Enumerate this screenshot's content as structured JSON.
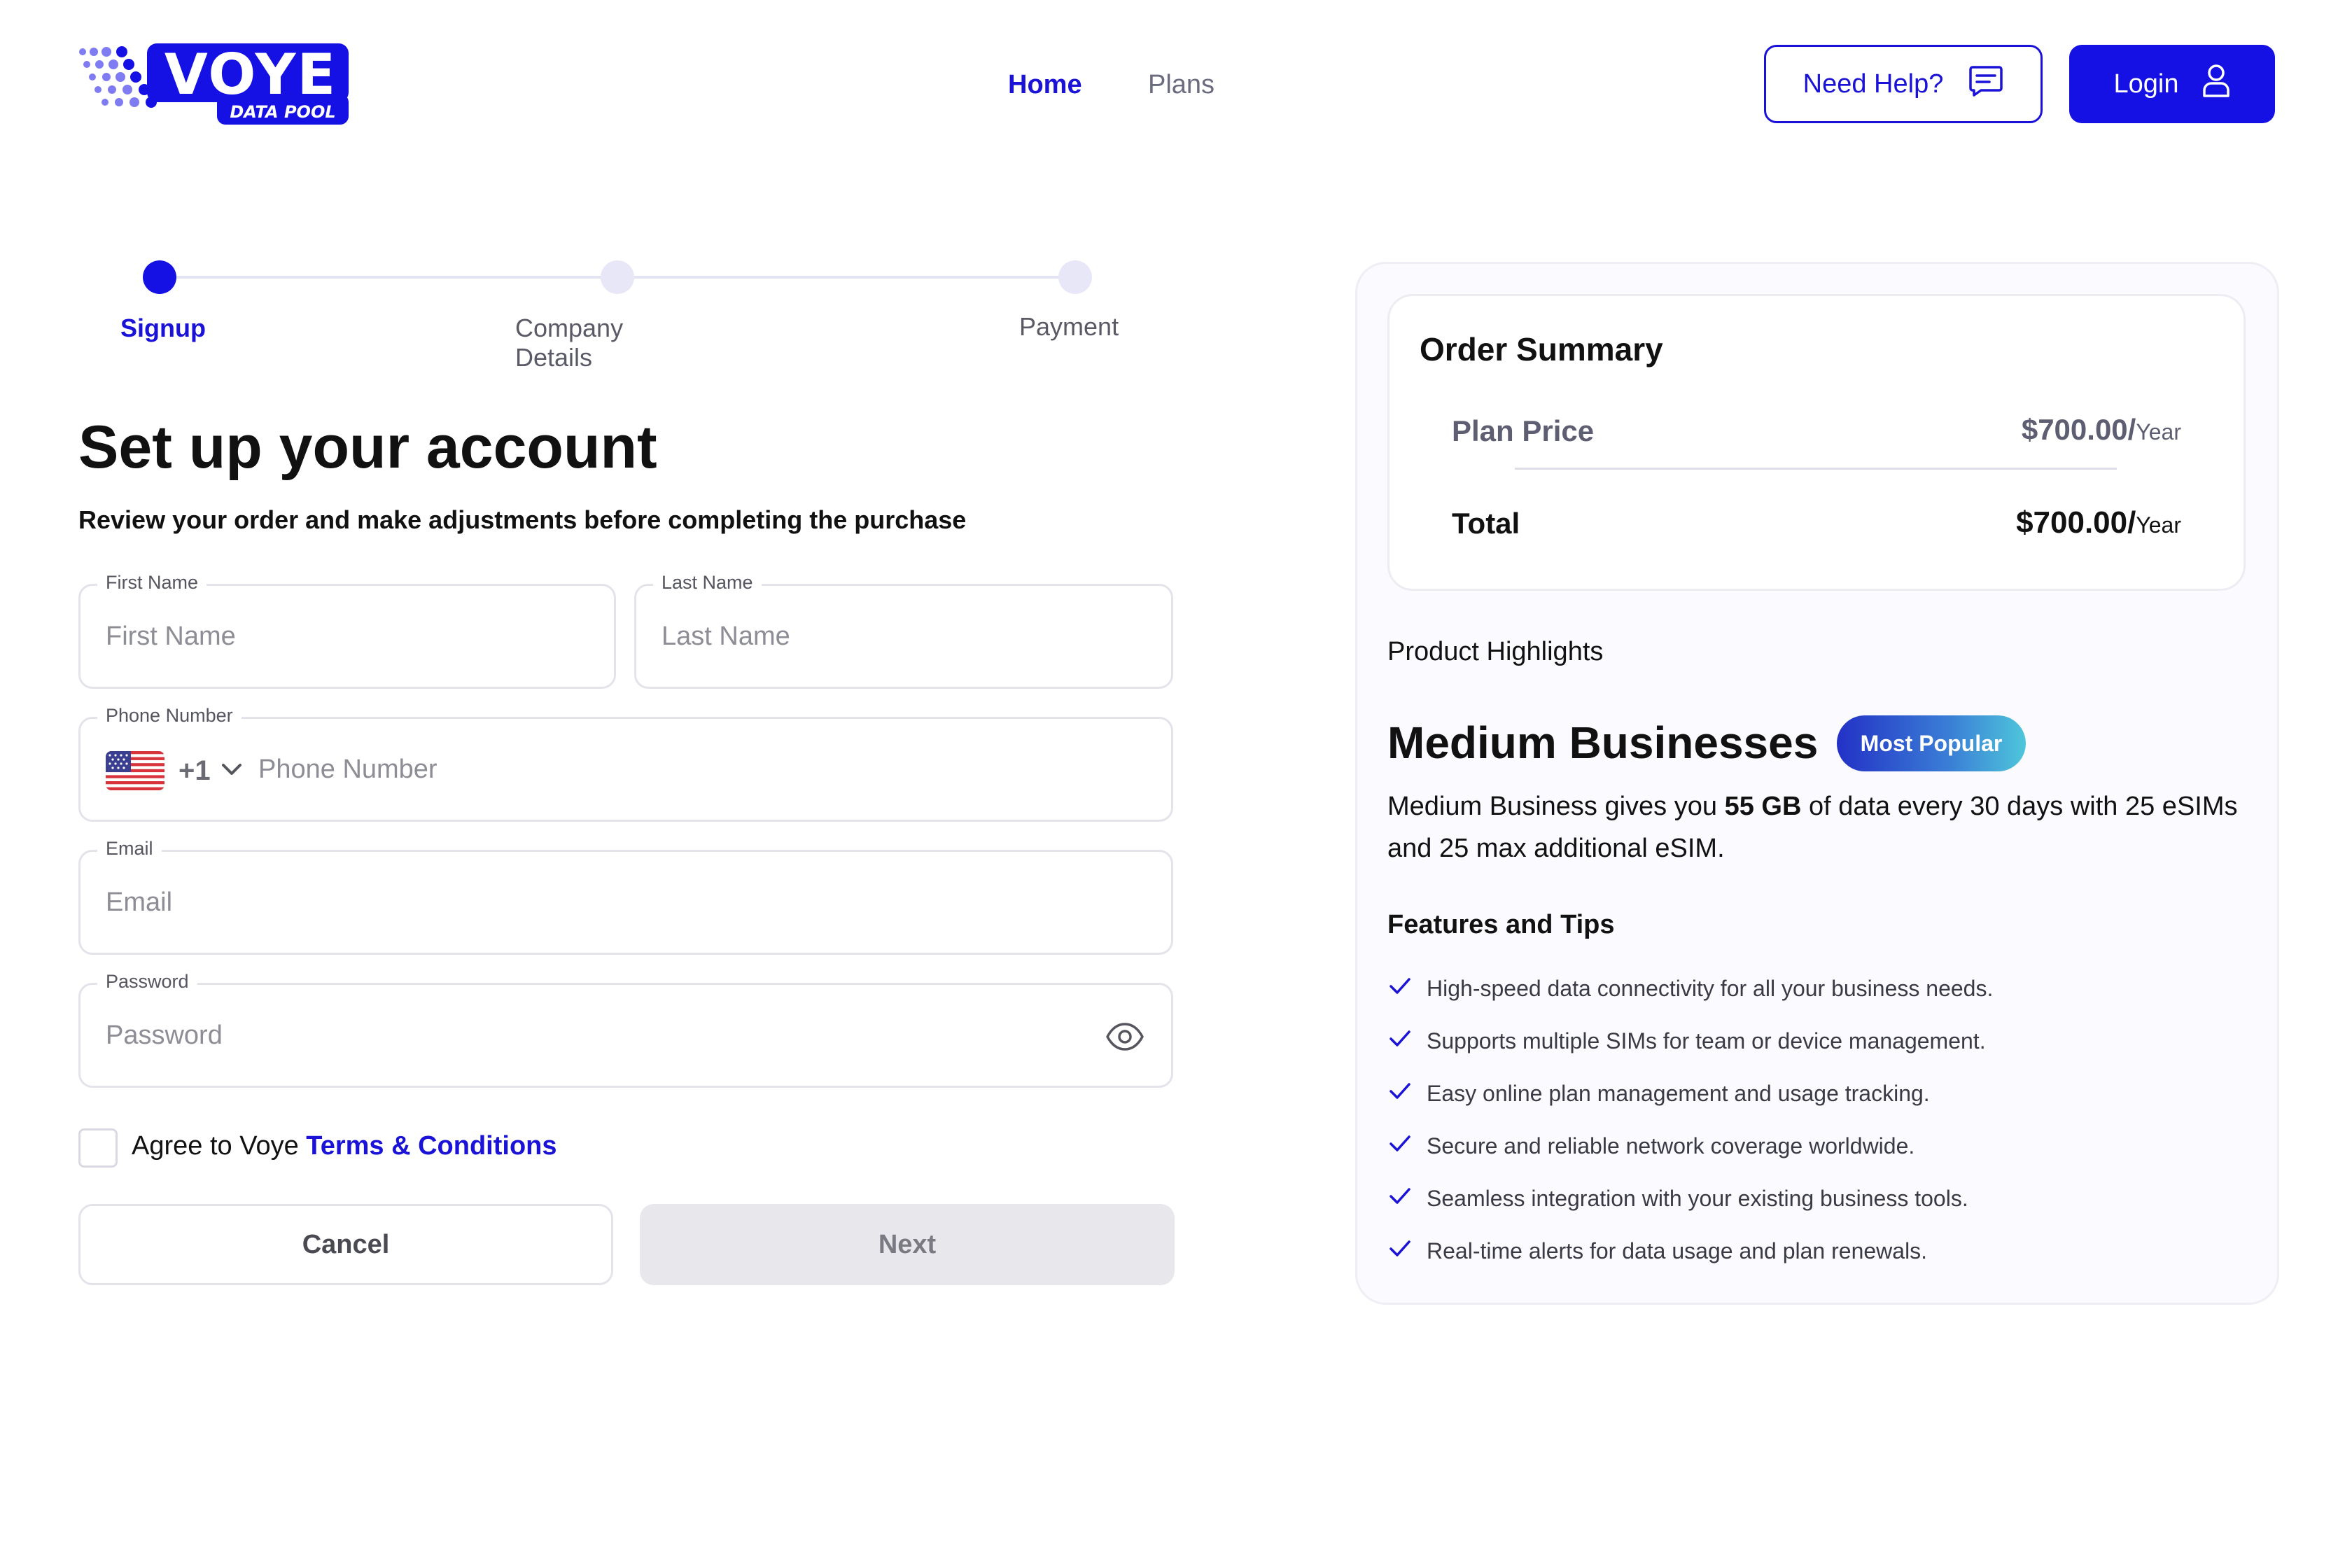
{
  "brand": {
    "logo_text": "VOYE",
    "logo_subtext": "DATA POOL",
    "accent": "#1510e3"
  },
  "nav": {
    "home": "Home",
    "plans": "Plans"
  },
  "header": {
    "help_label": "Need Help?",
    "login_label": "Login"
  },
  "stepper": {
    "steps": [
      {
        "label": "Signup",
        "state": "active"
      },
      {
        "label": "Company Details",
        "state": "inactive"
      },
      {
        "label": "Payment",
        "state": "inactive"
      }
    ]
  },
  "form": {
    "title": "Set up your account",
    "subtitle": "Review your order and make adjustments before completing the purchase",
    "first_name": {
      "label": "First Name",
      "placeholder": "First Name"
    },
    "last_name": {
      "label": "Last Name",
      "placeholder": "Last Name"
    },
    "phone": {
      "label": "Phone Number",
      "country_code": "+1",
      "placeholder": "Phone Number"
    },
    "email": {
      "label": "Email",
      "placeholder": "Email"
    },
    "password": {
      "label": "Password",
      "placeholder": "Password"
    },
    "agree_text": "Agree to Voye",
    "terms_link": "Terms & Conditions",
    "cancel_label": "Cancel",
    "next_label": "Next"
  },
  "order": {
    "title": "Order Summary",
    "plan_price_label": "Plan Price",
    "plan_price_value": "$700.00/",
    "plan_price_period": "Year",
    "total_label": "Total",
    "total_value": "$700.00/",
    "total_period": "Year"
  },
  "product": {
    "highlights_label": "Product Highlights",
    "name": "Medium Businesses",
    "badge": "Most Popular",
    "desc_pre": "Medium Business gives you",
    "desc_bold": "55 GB",
    "desc_post": "of data every 30 days with 25 eSIMs and 25 max additional eSIM.",
    "features_title": "Features and Tips",
    "features": [
      "High-speed data connectivity for all your business needs.",
      "Supports multiple SIMs for team or device management.",
      "Easy online plan management and usage tracking.",
      "Secure and reliable network coverage worldwide.",
      "Seamless integration with your existing business tools.",
      "Real-time alerts for data usage and plan renewals."
    ]
  },
  "icons": {
    "help": "chat-bubble-icon",
    "login": "user-icon",
    "dropdown": "chevron-down-icon",
    "password_toggle": "eye-icon",
    "feature": "check-icon",
    "flag": "us-flag-icon"
  }
}
